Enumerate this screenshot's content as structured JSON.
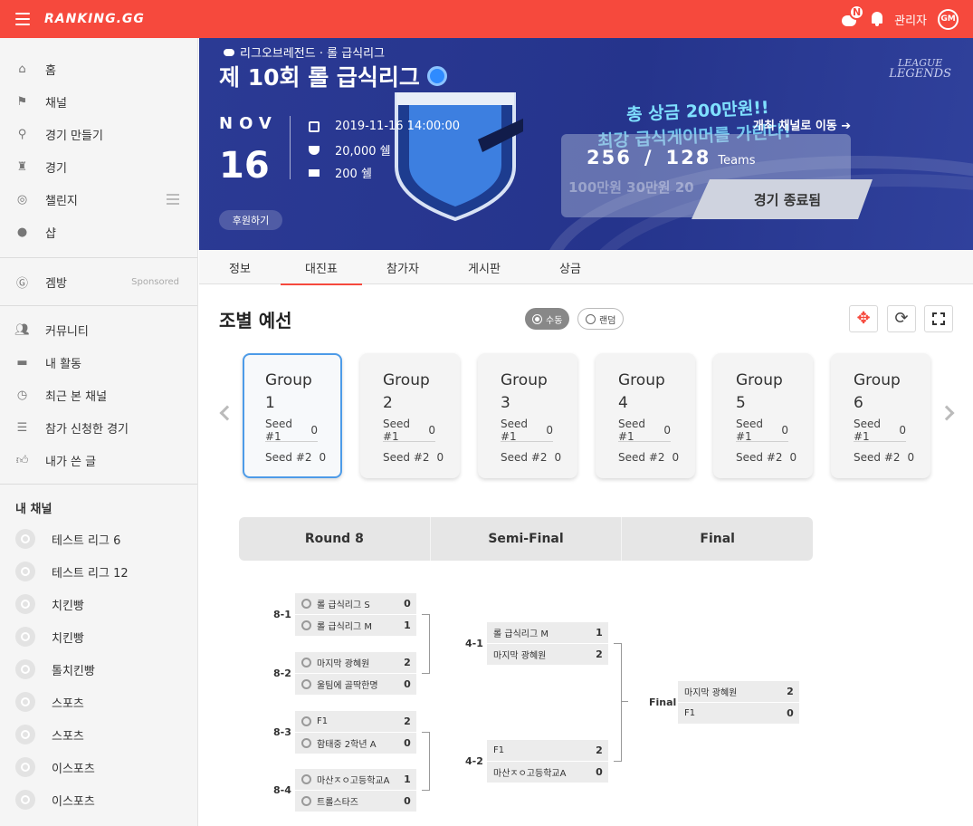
{
  "topbar": {
    "logo": "RANKING.GG",
    "badge": "N",
    "user": "관리자",
    "avatar": "GM"
  },
  "sidebar": {
    "main_items": [
      {
        "label": "홈",
        "icon": "home-icon"
      },
      {
        "label": "채널",
        "icon": "flag-icon"
      },
      {
        "label": "경기 만들기",
        "icon": "magnifier-icon"
      },
      {
        "label": "경기",
        "icon": "trophy-icon"
      },
      {
        "label": "챌린지",
        "icon": "target-icon"
      },
      {
        "label": "샵",
        "icon": "shop-icon"
      }
    ],
    "sponsored_item": {
      "label": "겜방",
      "sponsored": "Sponsored"
    },
    "community_items": [
      {
        "label": "커뮤니티",
        "icon": "people-icon"
      },
      {
        "label": "내 활동",
        "icon": "folder-icon"
      },
      {
        "label": "최근 본 채널",
        "icon": "history-icon"
      },
      {
        "label": "참가 신청한 경기",
        "icon": "list-icon"
      },
      {
        "label": "내가 쓴 글",
        "icon": "thumbs-up-icon"
      }
    ],
    "my_channels_heading": "내 채널",
    "channels": [
      "테스트 리그 6",
      "테스트 리그 12",
      "치킨빵",
      "치킨빵",
      "톨치킨빵",
      "스포츠",
      "스포츠",
      "이스포츠",
      "이스포츠"
    ]
  },
  "banner": {
    "game": "리그오브레전드 · 롤 급식리그",
    "title": "제 10회 롤 급식리그",
    "month": "NOV",
    "day": "16",
    "datetime": "2019-11-16 14:00:00",
    "prize": "20,000 쉘",
    "entry_fee": "200 쉘",
    "support": "후원하기",
    "lol_logo_line1": "LEAGUE",
    "lol_logo_line2": "LEGENDS",
    "promo_line1": "총 상금 200만원!!",
    "promo_line2": "최강 급식게이머를 가린다!",
    "move_channel": "개최 채널로 이동 ➔",
    "teams_current": "256",
    "teams_sep": "/",
    "teams_max": "128",
    "teams_label": "Teams",
    "prize_faint": "100만원  30만원  20",
    "status": "경기 종료됨"
  },
  "tabs": [
    "정보",
    "대진표",
    "참가자",
    "게시판",
    "상금"
  ],
  "active_tab": "대진표",
  "section": {
    "title": "조별 예선",
    "manual": "수동",
    "random": "랜덤"
  },
  "groups": [
    {
      "line1": "Group",
      "line2": "1",
      "seed1": "Seed #1",
      "seed1_score": "0",
      "seed2": "Seed #2",
      "seed2_score": "0"
    },
    {
      "line1": "Group",
      "line2": "2",
      "seed1": "Seed #1",
      "seed1_score": "0",
      "seed2": "Seed #2",
      "seed2_score": "0"
    },
    {
      "line1": "Group",
      "line2": "3",
      "seed1": "Seed #1",
      "seed1_score": "0",
      "seed2": "Seed #2",
      "seed2_score": "0"
    },
    {
      "line1": "Group",
      "line2": "4",
      "seed1": "Seed #1",
      "seed1_score": "0",
      "seed2": "Seed #2",
      "seed2_score": "0"
    },
    {
      "line1": "Group",
      "line2": "5",
      "seed1": "Seed #1",
      "seed1_score": "0",
      "seed2": "Seed #2",
      "seed2_score": "0"
    },
    {
      "line1": "Group",
      "line2": "6",
      "seed1": "Seed #1",
      "seed1_score": "0",
      "seed2": "Seed #2",
      "seed2_score": "0"
    }
  ],
  "rounds": [
    "Round 8",
    "Semi-Final",
    "Final"
  ],
  "bracket": {
    "round8": [
      {
        "label": "8-1",
        "a": "롤 급식리그 S",
        "a_score": "0",
        "b": "롤 급식리그 M",
        "b_score": "1"
      },
      {
        "label": "8-2",
        "a": "마지막 광혜원",
        "a_score": "2",
        "b": "울팀에 골딱한명",
        "b_score": "0"
      },
      {
        "label": "8-3",
        "a": "F1",
        "a_score": "2",
        "b": "함태중 2학년 A",
        "b_score": "0"
      },
      {
        "label": "8-4",
        "a": "마산ㅈㅇ고등학교A",
        "a_score": "1",
        "b": "트롤스타즈",
        "b_score": "0"
      }
    ],
    "semi": [
      {
        "label": "4-1",
        "a": "롤 급식리그 M",
        "a_score": "1",
        "b": "마지막 광혜원",
        "b_score": "2"
      },
      {
        "label": "4-2",
        "a": "F1",
        "a_score": "2",
        "b": "마산ㅈㅇ고등학교A",
        "b_score": "0"
      }
    ],
    "final": {
      "label": "Final",
      "a": "마지막 광혜원",
      "a_score": "2",
      "b": "F1",
      "b_score": "0"
    }
  },
  "colors": {
    "accent": "#f6493d",
    "banner": "#2b3a94",
    "selected_border": "#4d9be8"
  }
}
